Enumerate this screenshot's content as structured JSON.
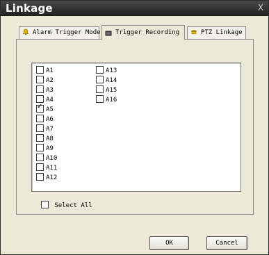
{
  "window": {
    "title": "Linkage",
    "close_label": "X"
  },
  "tabs": [
    {
      "label": "Alarm Trigger Mode",
      "icon": "bell-icon",
      "icon_color": "#e6b800",
      "active": false
    },
    {
      "label": "Trigger Recording",
      "icon": "recording-icon",
      "icon_color": "#2c2c2c",
      "active": true
    },
    {
      "label": "PTZ Linkage",
      "icon": "ptz-camera-icon",
      "icon_color": "#e6b800",
      "active": false
    }
  ],
  "alarm_inputs": [
    {
      "label": "A1",
      "checked": false
    },
    {
      "label": "A2",
      "checked": false
    },
    {
      "label": "A3",
      "checked": false
    },
    {
      "label": "A4",
      "checked": false
    },
    {
      "label": "A5",
      "checked": true
    },
    {
      "label": "A6",
      "checked": false
    },
    {
      "label": "A7",
      "checked": false
    },
    {
      "label": "A8",
      "checked": false
    },
    {
      "label": "A9",
      "checked": false
    },
    {
      "label": "A10",
      "checked": false
    },
    {
      "label": "A11",
      "checked": false
    },
    {
      "label": "A12",
      "checked": false
    },
    {
      "label": "A13",
      "checked": false
    },
    {
      "label": "A14",
      "checked": false
    },
    {
      "label": "A15",
      "checked": false
    },
    {
      "label": "A16",
      "checked": false
    }
  ],
  "select_all": {
    "label": "Select All",
    "checked": false
  },
  "buttons": {
    "ok": "OK",
    "cancel": "Cancel"
  }
}
